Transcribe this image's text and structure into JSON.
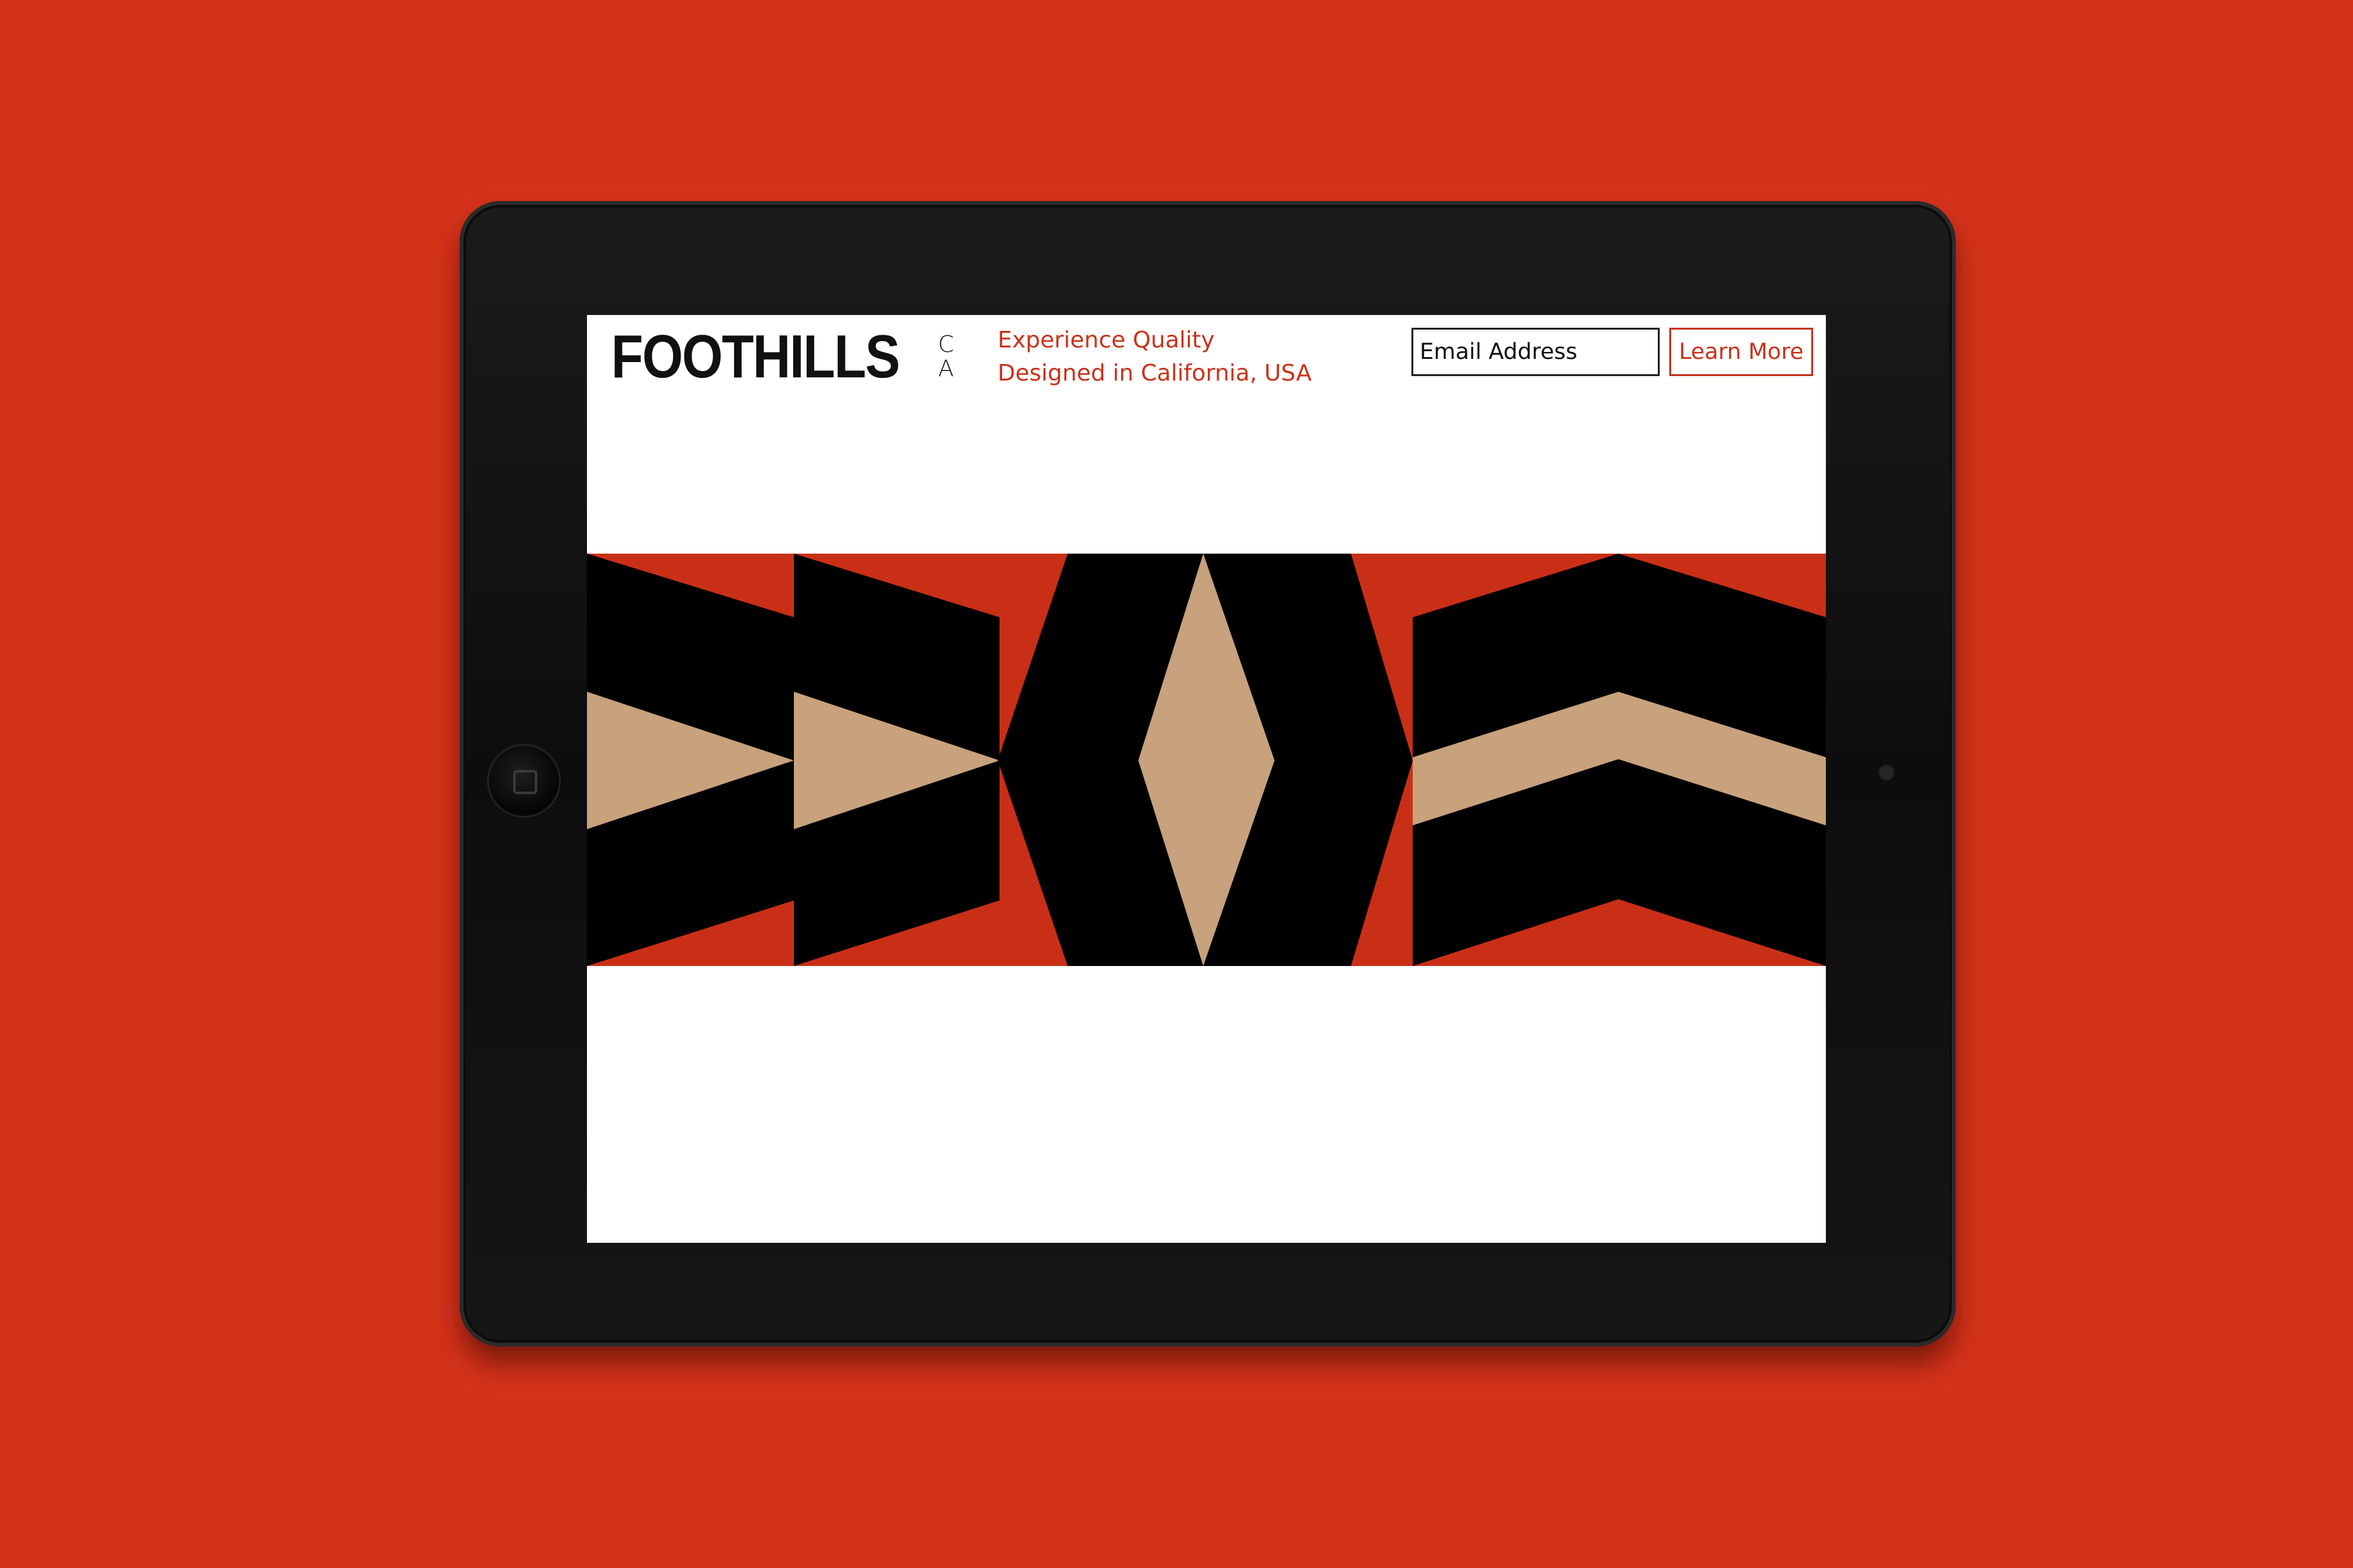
{
  "brand": {
    "logo_word": "FOOTHILLS",
    "logo_suffix_top": "C",
    "logo_suffix_bottom": "A"
  },
  "tagline": {
    "line1": "Experience Quality",
    "line2": "Designed in California, USA"
  },
  "signup": {
    "email_placeholder": "Email Address",
    "button_label": "Learn More"
  },
  "colors": {
    "background": "#d5321a",
    "accent": "#c8331c",
    "banner_red": "#c92f16",
    "kraft": "#c7a27c",
    "black": "#000000"
  },
  "icons": {
    "home_button": "home-button-icon",
    "camera": "front-camera-icon"
  }
}
